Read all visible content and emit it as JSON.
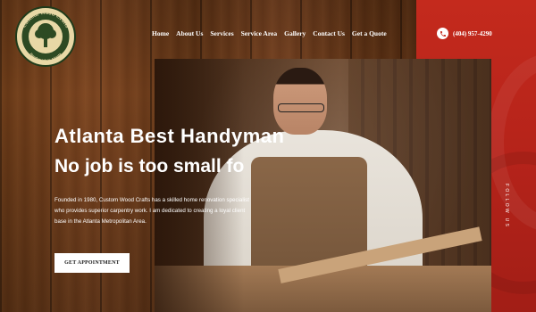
{
  "brand": {
    "logo_top_text": "Custom Wood Crafts",
    "logo_bottom_text": "Handymade in Atlanta",
    "colors": {
      "accent_red": "#c42a1d",
      "wood": "#6b3a17"
    }
  },
  "nav": {
    "items": [
      "Home",
      "About Us",
      "Services",
      "Service Area",
      "Gallery",
      "Contact Us",
      "Get a Quote"
    ]
  },
  "phone": {
    "icon": "phone-icon",
    "number": "(404) 957-4290"
  },
  "hero": {
    "title": "Atlanta Best Handyman",
    "subtitle": "No job is too small fo",
    "description": "Founded in 1980, Custom Wood Crafts has a skilled home renovation specialist who provides superior carpentry work. I am dedicated to creating a loyal client base in the Atlanta Metropolitan Area.",
    "cta_label": "GET APPOINTMENT"
  },
  "side": {
    "vertical_text": "FOLLOW US"
  }
}
